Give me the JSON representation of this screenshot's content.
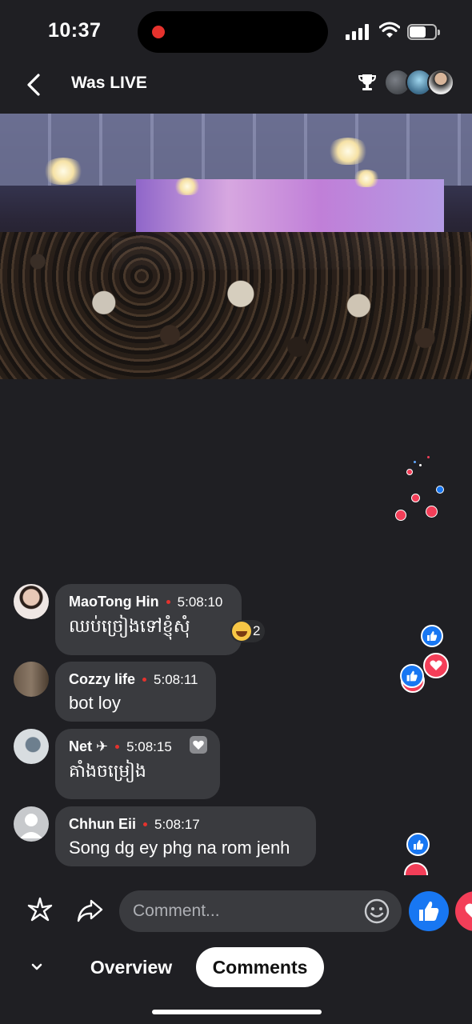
{
  "status_bar": {
    "time": "10:37",
    "recording": true
  },
  "header": {
    "back_icon": "chevron-left-icon",
    "title": "Was LIVE",
    "trophy_icon": "trophy-icon"
  },
  "comments": [
    {
      "name": "MaoTong Hin",
      "time": "5:08:10",
      "text": "ឈប់ច្រៀងទៅខ្ញុំសុំ",
      "reaction": {
        "icon": "laughing-emoji-icon",
        "count": "2"
      }
    },
    {
      "name": "Cozzy life",
      "time": "5:08:11",
      "text": "bot loy"
    },
    {
      "name": "Net ✈",
      "time": "5:08:15",
      "text": "គាំងចម្រៀង",
      "has_heart": true
    },
    {
      "name": "Chhun Eii",
      "time": "5:08:17",
      "text": "Song dg ey phg na rom jenh"
    }
  ],
  "composer": {
    "placeholder": "Comment...",
    "sparkle_icon": "sparkle-icon",
    "share_icon": "share-icon",
    "emoji_icon": "smile-icon"
  },
  "tabs": {
    "overview": "Overview",
    "comments": "Comments",
    "active": "comments"
  },
  "colors": {
    "like_blue": "#1877f2",
    "love_red": "#f33e58",
    "bubble": "#3a3b3f",
    "background": "#1f1f23"
  }
}
